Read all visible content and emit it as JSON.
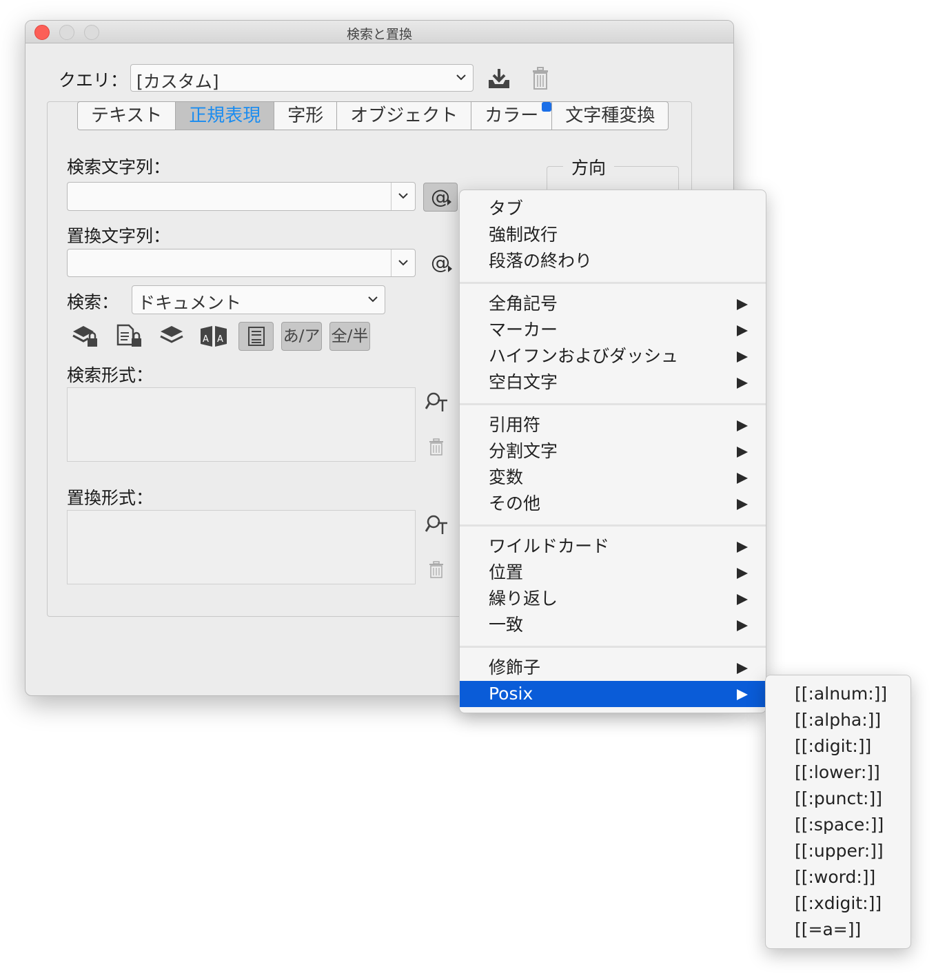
{
  "window": {
    "title": "検索と置換"
  },
  "query": {
    "label": "クエリ：",
    "value": "[カスタム]"
  },
  "tabs": [
    {
      "label": "テキスト"
    },
    {
      "label": "正規表現"
    },
    {
      "label": "字形"
    },
    {
      "label": "オブジェクト"
    },
    {
      "label": "カラー"
    },
    {
      "label": "文字種変換"
    }
  ],
  "find": {
    "label": "検索文字列：",
    "value": "",
    "special_char_button": "@"
  },
  "change": {
    "label": "置換文字列：",
    "value": "",
    "special_char_button": "@"
  },
  "direction": {
    "label": "方向"
  },
  "search": {
    "label": "検索：",
    "value": "ドキュメント"
  },
  "toolbar": {
    "kana_button": "あ/ア",
    "width_button": "全/半"
  },
  "find_format": {
    "label": "検索形式："
  },
  "change_format": {
    "label": "置換形式："
  },
  "menu": {
    "groups": [
      [
        "タブ",
        "強制改行",
        "段落の終わり"
      ],
      [
        "全角記号",
        "マーカー",
        "ハイフンおよびダッシュ",
        "空白文字"
      ],
      [
        "引用符",
        "分割文字",
        "変数",
        "その他"
      ],
      [
        "ワイルドカード",
        "位置",
        "繰り返し",
        "一致"
      ],
      [
        "修飾子",
        "Posix"
      ]
    ],
    "highlighted": "Posix",
    "highlight_color": "#0a5cd8"
  },
  "submenu": {
    "items": [
      "[[:alnum:]]",
      "[[:alpha:]]",
      "[[:digit:]]",
      "[[:lower:]]",
      "[[:punct:]]",
      "[[:space:]]",
      "[[:upper:]]",
      "[[:word:]]",
      "[[:xdigit:]]",
      "[[=a=]]"
    ]
  }
}
